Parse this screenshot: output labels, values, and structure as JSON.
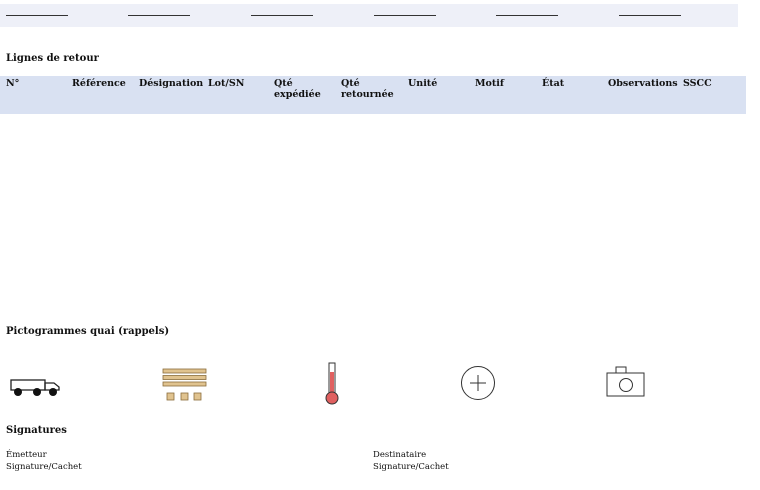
{
  "sections": {
    "lines_title": "Lignes de retour",
    "pictos_title": "Pictogrammes quai (rappels)",
    "signatures_title": "Signatures"
  },
  "table": {
    "headers": [
      "N°",
      "Référence",
      "Désignation",
      "Lot/SN",
      "Qté expédiée",
      "Qté retournée",
      "Unité",
      "Motif",
      "État",
      "Observations",
      "SSCC"
    ]
  },
  "signatures": {
    "sender_label": "Émetteur",
    "sender_sub": "Signature/Cachet",
    "receiver_label": "Destinataire",
    "receiver_sub": "Signature/Cachet"
  },
  "icons": [
    "truck-icon",
    "pallet-icon",
    "thermometer-icon",
    "plus-circle-icon",
    "camera-icon"
  ],
  "colors": {
    "top_band": "#eef0f8",
    "table_header": "#d9e1f2",
    "pallet": "#e0c38f",
    "thermometer": "#e06060"
  }
}
